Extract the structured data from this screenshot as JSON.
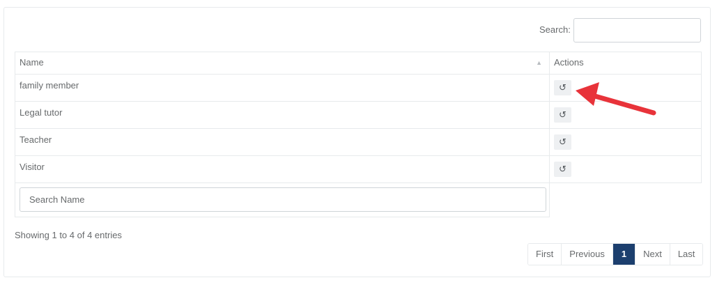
{
  "search": {
    "label": "Search:",
    "value": ""
  },
  "table": {
    "headers": {
      "name": "Name",
      "actions": "Actions"
    },
    "rows": [
      {
        "name": "family member",
        "action_icon": "undo-icon"
      },
      {
        "name": "Legal tutor",
        "action_icon": "undo-icon"
      },
      {
        "name": "Teacher",
        "action_icon": "undo-icon"
      },
      {
        "name": "Visitor",
        "action_icon": "undo-icon"
      }
    ],
    "filter_placeholder": "Search Name"
  },
  "info": "Showing 1 to 4 of 4 entries",
  "pagination": {
    "first": "First",
    "previous": "Previous",
    "current": "1",
    "next": "Next",
    "last": "Last"
  },
  "colors": {
    "active_page": "#1c3f6e",
    "annotation_arrow": "#e8333a"
  }
}
